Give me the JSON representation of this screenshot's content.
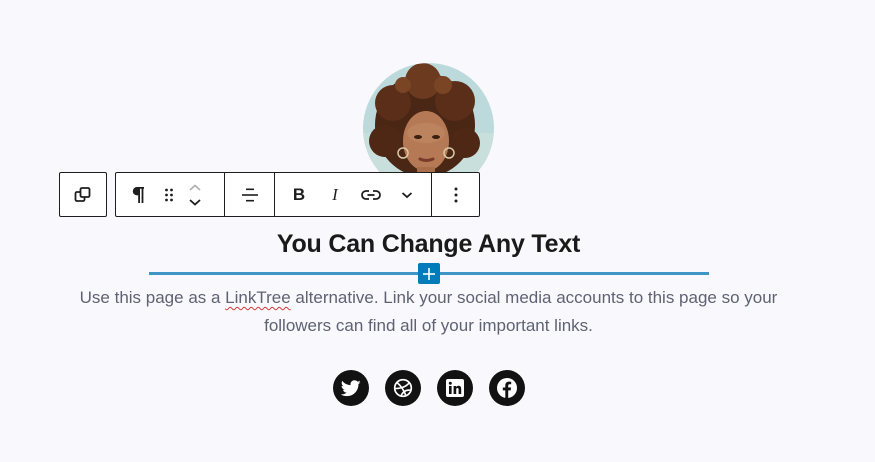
{
  "avatar": {
    "alt": "Profile photo"
  },
  "toolbar": {
    "parent_icon": "select-parent-icon",
    "block_type_icon": "paragraph-icon",
    "drag_icon": "drag-handle-icon",
    "move_up_icon": "chevron-up-icon",
    "move_down_icon": "chevron-down-icon",
    "align_icon": "align-center-icon",
    "bold_label": "B",
    "italic_label": "I",
    "link_icon": "link-icon",
    "more_formats_icon": "chevron-down-icon",
    "options_icon": "more-vertical-icon"
  },
  "heading": "You Can Change Any Text",
  "paragraph": {
    "before": "Use this page as a ",
    "misspelled": "LinkTree",
    "after": " alternative. Link your social media accounts to this page so your followers can find all of your important links."
  },
  "inserter": {
    "icon": "plus-icon"
  },
  "social_links": [
    "twitter",
    "dribbble",
    "linkedin",
    "facebook"
  ],
  "colors": {
    "background": "#f9f9fd",
    "accent": "#007cba",
    "indicator": "#3f95c5",
    "text": "#5e6272",
    "heading": "#1a1a1a"
  }
}
